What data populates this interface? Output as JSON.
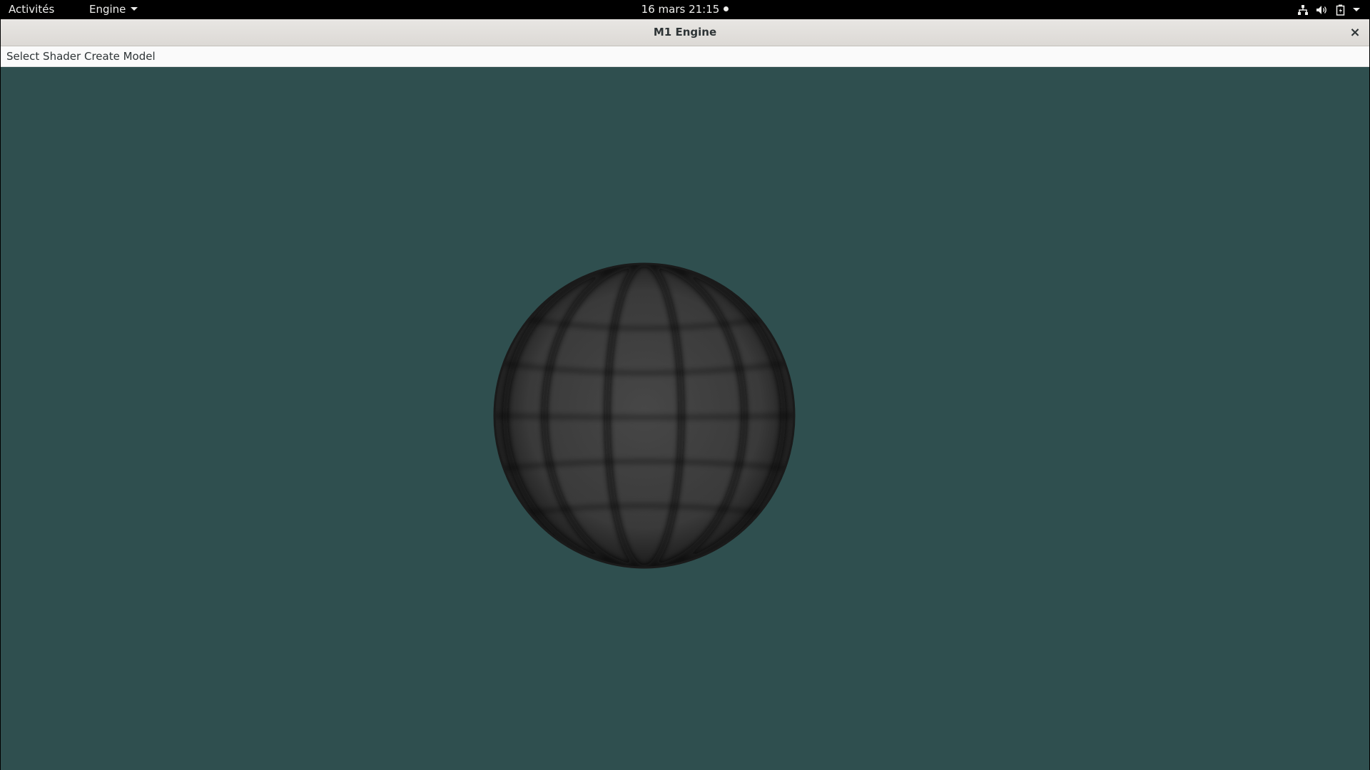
{
  "topbar": {
    "activities": "Activités",
    "app_menu": "Engine",
    "clock": "16 mars  21:15",
    "icons": [
      "network-icon",
      "volume-icon",
      "battery-icon",
      "system-menu-chevron-icon"
    ]
  },
  "window": {
    "title": "M1 Engine",
    "close_glyph": "×"
  },
  "menubar": {
    "items": [
      "Select Shader",
      "Create Model"
    ]
  },
  "viewport": {
    "background_color": "#2f4f4f",
    "object": "sphere",
    "object_color": "#3c3c3c"
  }
}
